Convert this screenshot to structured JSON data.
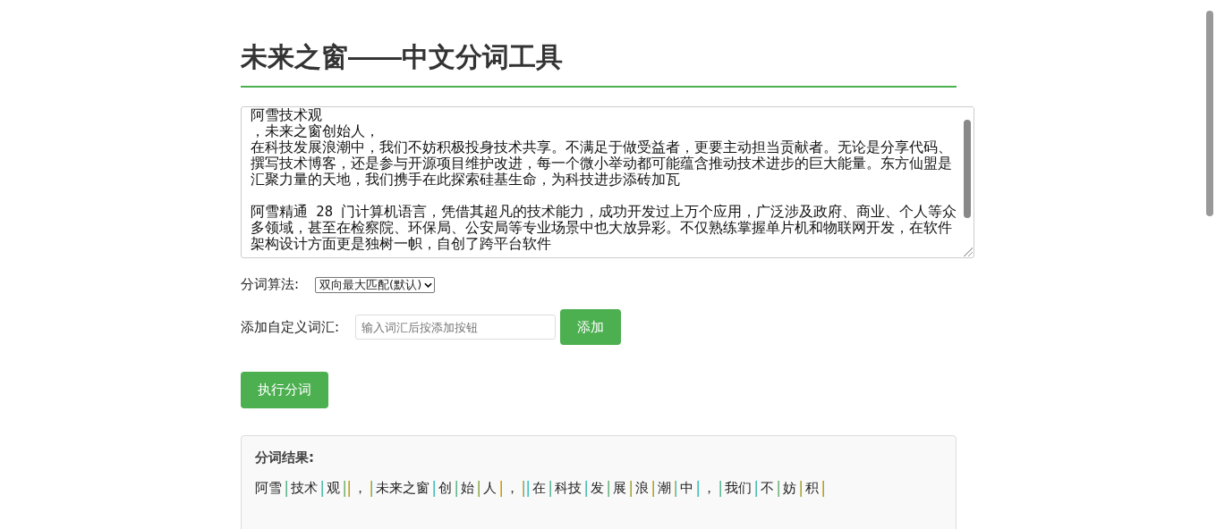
{
  "title": "未来之窗——中文分词工具",
  "input": {
    "paragraphs": [
      [
        "阿雪技术观",
        "，未来之窗创始人，",
        "在科技发展浪潮中，我们不妨积极投身技术共享。不满足于做受益者，更要主动担当贡献者。无论是分享代码、",
        "撰写技术博客，还是参与开源项目维护改进，每一个微小举动都可能蕴含推动技术进步的巨大能量。东方仙盟是",
        "汇聚力量的天地，我们携手在此探索硅基生命，为科技进步添砖加瓦"
      ],
      [
        "阿雪精通 28 门计算机语言，凭借其超凡的技术能力，成功开发过上万个应用，广泛涉及政府、商业、个人等众",
        "多领域，甚至在检察院、环保局、公安局等专业场景中也大放异彩。不仅熟练掌握单片机和物联网开发，在软件",
        "架构设计方面更是独树一帜，自创了跨平台软件"
      ]
    ]
  },
  "algorithm": {
    "label": "分词算法:",
    "value": "双向最大匹配(默认)"
  },
  "custom_word": {
    "label": "添加自定义词汇:",
    "placeholder": "输入词汇后按添加按钮",
    "button": "添加"
  },
  "run_button": "执行分词",
  "result": {
    "heading": "分词结果:",
    "tokens": [
      {
        "kind": "word",
        "text": "阿雪"
      },
      {
        "kind": "word",
        "text": "技术"
      },
      {
        "kind": "word",
        "text": "观"
      },
      {
        "kind": "break"
      },
      {
        "kind": "word",
        "text": "，"
      },
      {
        "kind": "word",
        "text": "未来之窗"
      },
      {
        "kind": "word",
        "text": "创"
      },
      {
        "kind": "word",
        "text": "始"
      },
      {
        "kind": "word",
        "text": "人"
      },
      {
        "kind": "word",
        "text": "，"
      },
      {
        "kind": "break"
      },
      {
        "kind": "word",
        "text": "在"
      },
      {
        "kind": "word",
        "text": "科技"
      },
      {
        "kind": "word",
        "text": "发"
      },
      {
        "kind": "word",
        "text": "展"
      },
      {
        "kind": "word",
        "text": "浪"
      },
      {
        "kind": "word",
        "text": "潮"
      },
      {
        "kind": "word",
        "text": "中"
      },
      {
        "kind": "word",
        "text": "，"
      },
      {
        "kind": "word",
        "text": "我们"
      },
      {
        "kind": "word",
        "text": "不"
      },
      {
        "kind": "word",
        "text": "妨"
      },
      {
        "kind": "word",
        "text": "积"
      }
    ]
  }
}
